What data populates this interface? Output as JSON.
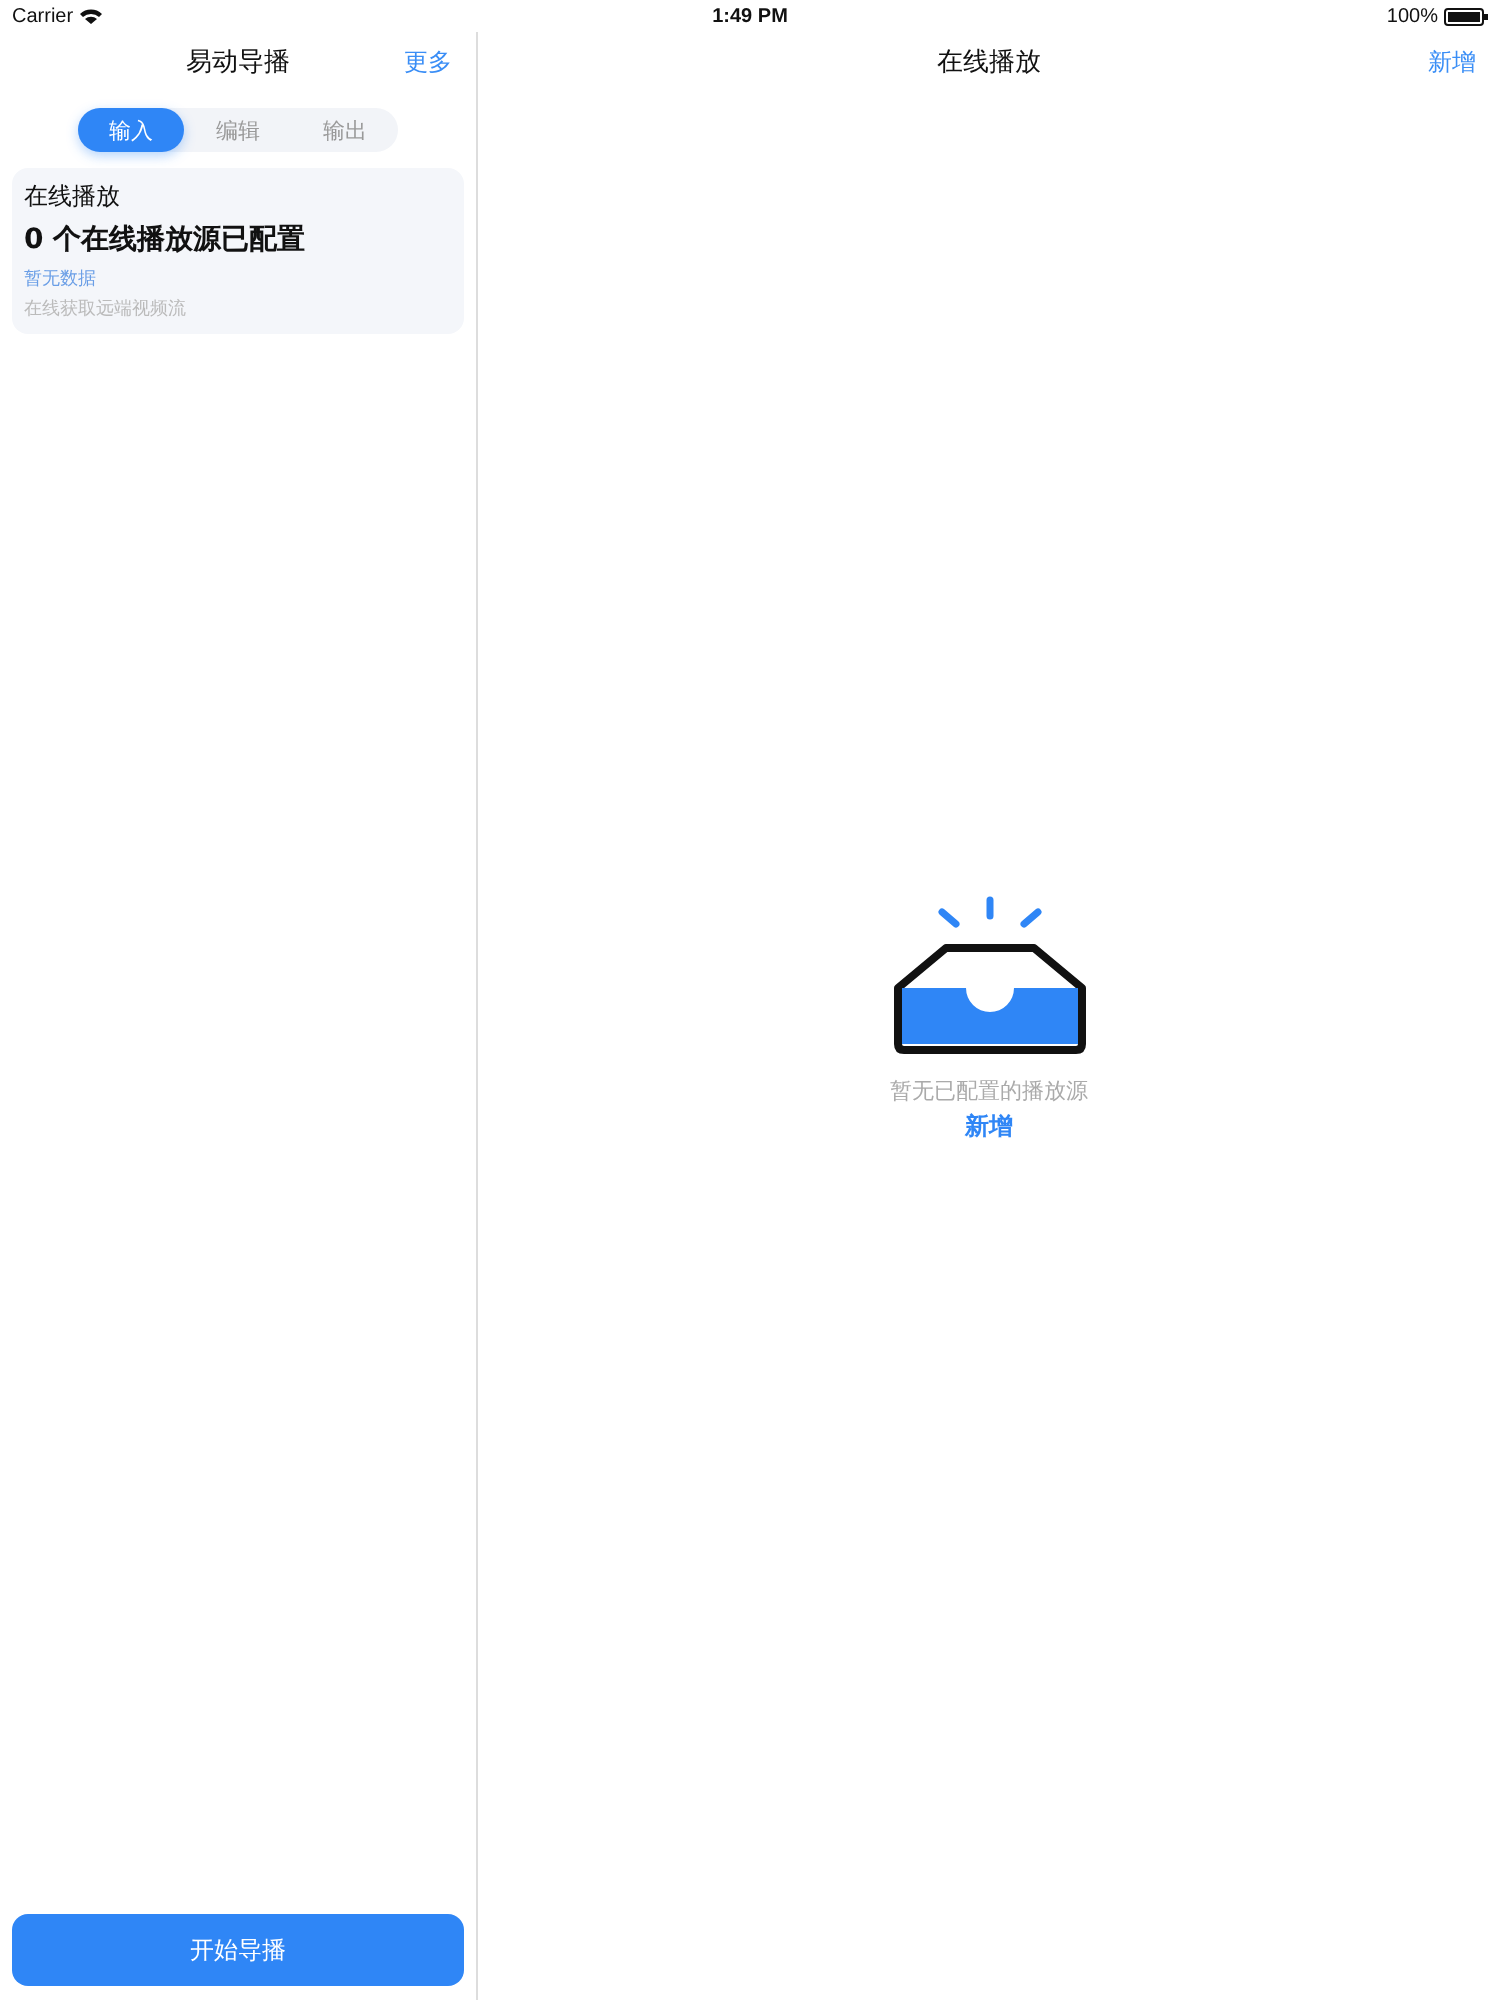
{
  "status_bar": {
    "carrier": "Carrier",
    "time": "1:49 PM",
    "battery": "100%"
  },
  "sidebar": {
    "title": "易动导播",
    "more": "更多",
    "tabs": [
      {
        "label": "输入",
        "selected": true
      },
      {
        "label": "编辑",
        "selected": false
      },
      {
        "label": "输出",
        "selected": false
      }
    ],
    "card": {
      "title": "在线播放",
      "summary": "0 个在线播放源已配置",
      "empty": "暂无数据",
      "description": "在线获取远端视频流"
    },
    "start_button": "开始导播"
  },
  "main": {
    "title": "在线播放",
    "add": "新增",
    "empty_text": "暂无已配置的播放源",
    "empty_add": "新增"
  }
}
